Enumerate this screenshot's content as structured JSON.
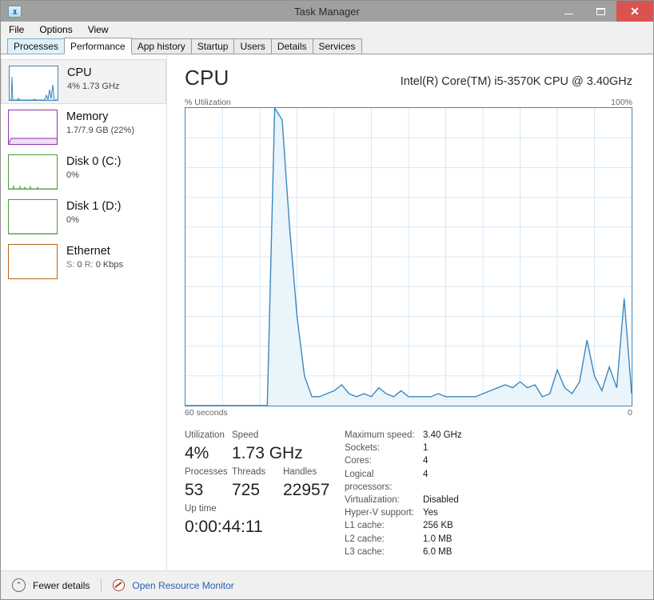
{
  "window": {
    "title": "Task Manager",
    "icon": "task-manager-icon",
    "minimize": "–",
    "maximize": "❑",
    "close": "✕"
  },
  "menu": [
    {
      "label": "File"
    },
    {
      "label": "Options"
    },
    {
      "label": "View"
    }
  ],
  "tabs": [
    {
      "label": "Processes",
      "state": "hover"
    },
    {
      "label": "Performance",
      "state": "active"
    },
    {
      "label": "App history",
      "state": "normal"
    },
    {
      "label": "Startup",
      "state": "normal"
    },
    {
      "label": "Users",
      "state": "normal"
    },
    {
      "label": "Details",
      "state": "normal"
    },
    {
      "label": "Services",
      "state": "normal"
    }
  ],
  "sidebar": {
    "items": [
      {
        "title": "CPU",
        "subtitle": "4%  1.73 GHz",
        "color": "#3c87bd",
        "selected": true
      },
      {
        "title": "Memory",
        "subtitle": "1.7/7.9 GB (22%)",
        "color": "#8c34a8",
        "selected": false
      },
      {
        "title": "Disk 0 (C:)",
        "subtitle": "0%",
        "color": "#4d9c3f",
        "selected": false
      },
      {
        "title": "Disk 1 (D:)",
        "subtitle": "0%",
        "color": "#4d9c3f",
        "selected": false
      },
      {
        "title": "Ethernet",
        "subtitle_parts": {
          "s_label": "S:",
          "s_value": "0",
          "r_label": "R:",
          "r_value": "0 Kbps"
        },
        "subtitle": "S: 0 R: 0 Kbps",
        "color": "#b5651d",
        "selected": false
      }
    ]
  },
  "main": {
    "heading": "CPU",
    "cpu_model": "Intel(R) Core(TM) i5-3570K CPU @ 3.40GHz",
    "axis_y_label": "% Utilization",
    "axis_y_max": "100%",
    "axis_x_left": "60 seconds",
    "axis_x_right": "0"
  },
  "chart_data": {
    "type": "area",
    "title": "CPU % Utilization",
    "xlabel": "60 seconds",
    "ylabel": "% Utilization",
    "ylim": [
      0,
      100
    ],
    "xlim": [
      60,
      0
    ],
    "grid": true,
    "grid_rows": 10,
    "grid_cols": 12,
    "line_color": "#3c87bd",
    "fill_color": "#eaf4fb",
    "x": [
      0,
      1,
      2,
      3,
      4,
      5,
      6,
      7,
      8,
      9,
      10,
      11,
      12,
      13,
      14,
      15,
      16,
      17,
      18,
      19,
      20,
      21,
      22,
      23,
      24,
      25,
      26,
      27,
      28,
      29,
      30,
      31,
      32,
      33,
      34,
      35,
      36,
      37,
      38,
      39,
      40,
      41,
      42,
      43,
      44,
      45,
      46,
      47,
      48,
      49,
      50,
      51,
      52,
      53,
      54,
      55,
      56,
      57,
      58,
      59,
      60
    ],
    "values": [
      0,
      0,
      0,
      0,
      0,
      0,
      0,
      0,
      0,
      0,
      0,
      0,
      100,
      96,
      60,
      30,
      10,
      3,
      3,
      4,
      5,
      7,
      4,
      3,
      4,
      3,
      6,
      4,
      3,
      5,
      3,
      3,
      3,
      3,
      4,
      3,
      3,
      3,
      3,
      3,
      4,
      5,
      6,
      7,
      6,
      8,
      6,
      7,
      3,
      4,
      12,
      6,
      4,
      8,
      22,
      10,
      5,
      13,
      6,
      36,
      4
    ]
  },
  "stats": {
    "groups": [
      [
        {
          "label": "Utilization",
          "value": "4%"
        },
        {
          "label": "Speed",
          "value": "1.73 GHz"
        }
      ],
      [
        {
          "label": "Processes",
          "value": "53"
        },
        {
          "label": "Threads",
          "value": "725"
        },
        {
          "label": "Handles",
          "value": "22957"
        }
      ],
      [
        {
          "label": "Up time",
          "value": "0:00:44:11"
        }
      ]
    ],
    "details": [
      {
        "key": "Maximum speed:",
        "value": "3.40 GHz"
      },
      {
        "key": "Sockets:",
        "value": "1"
      },
      {
        "key": "Cores:",
        "value": "4"
      },
      {
        "key": "Logical processors:",
        "value": "4"
      },
      {
        "key": "Virtualization:",
        "value": "Disabled"
      },
      {
        "key": "Hyper-V support:",
        "value": "Yes"
      },
      {
        "key": "L1 cache:",
        "value": "256 KB"
      },
      {
        "key": "L2 cache:",
        "value": "1.0 MB"
      },
      {
        "key": "L3 cache:",
        "value": "6.0 MB"
      }
    ]
  },
  "footer": {
    "chevron": "⌃",
    "fewer_details": "Fewer details",
    "resource_monitor": "Open Resource Monitor"
  }
}
